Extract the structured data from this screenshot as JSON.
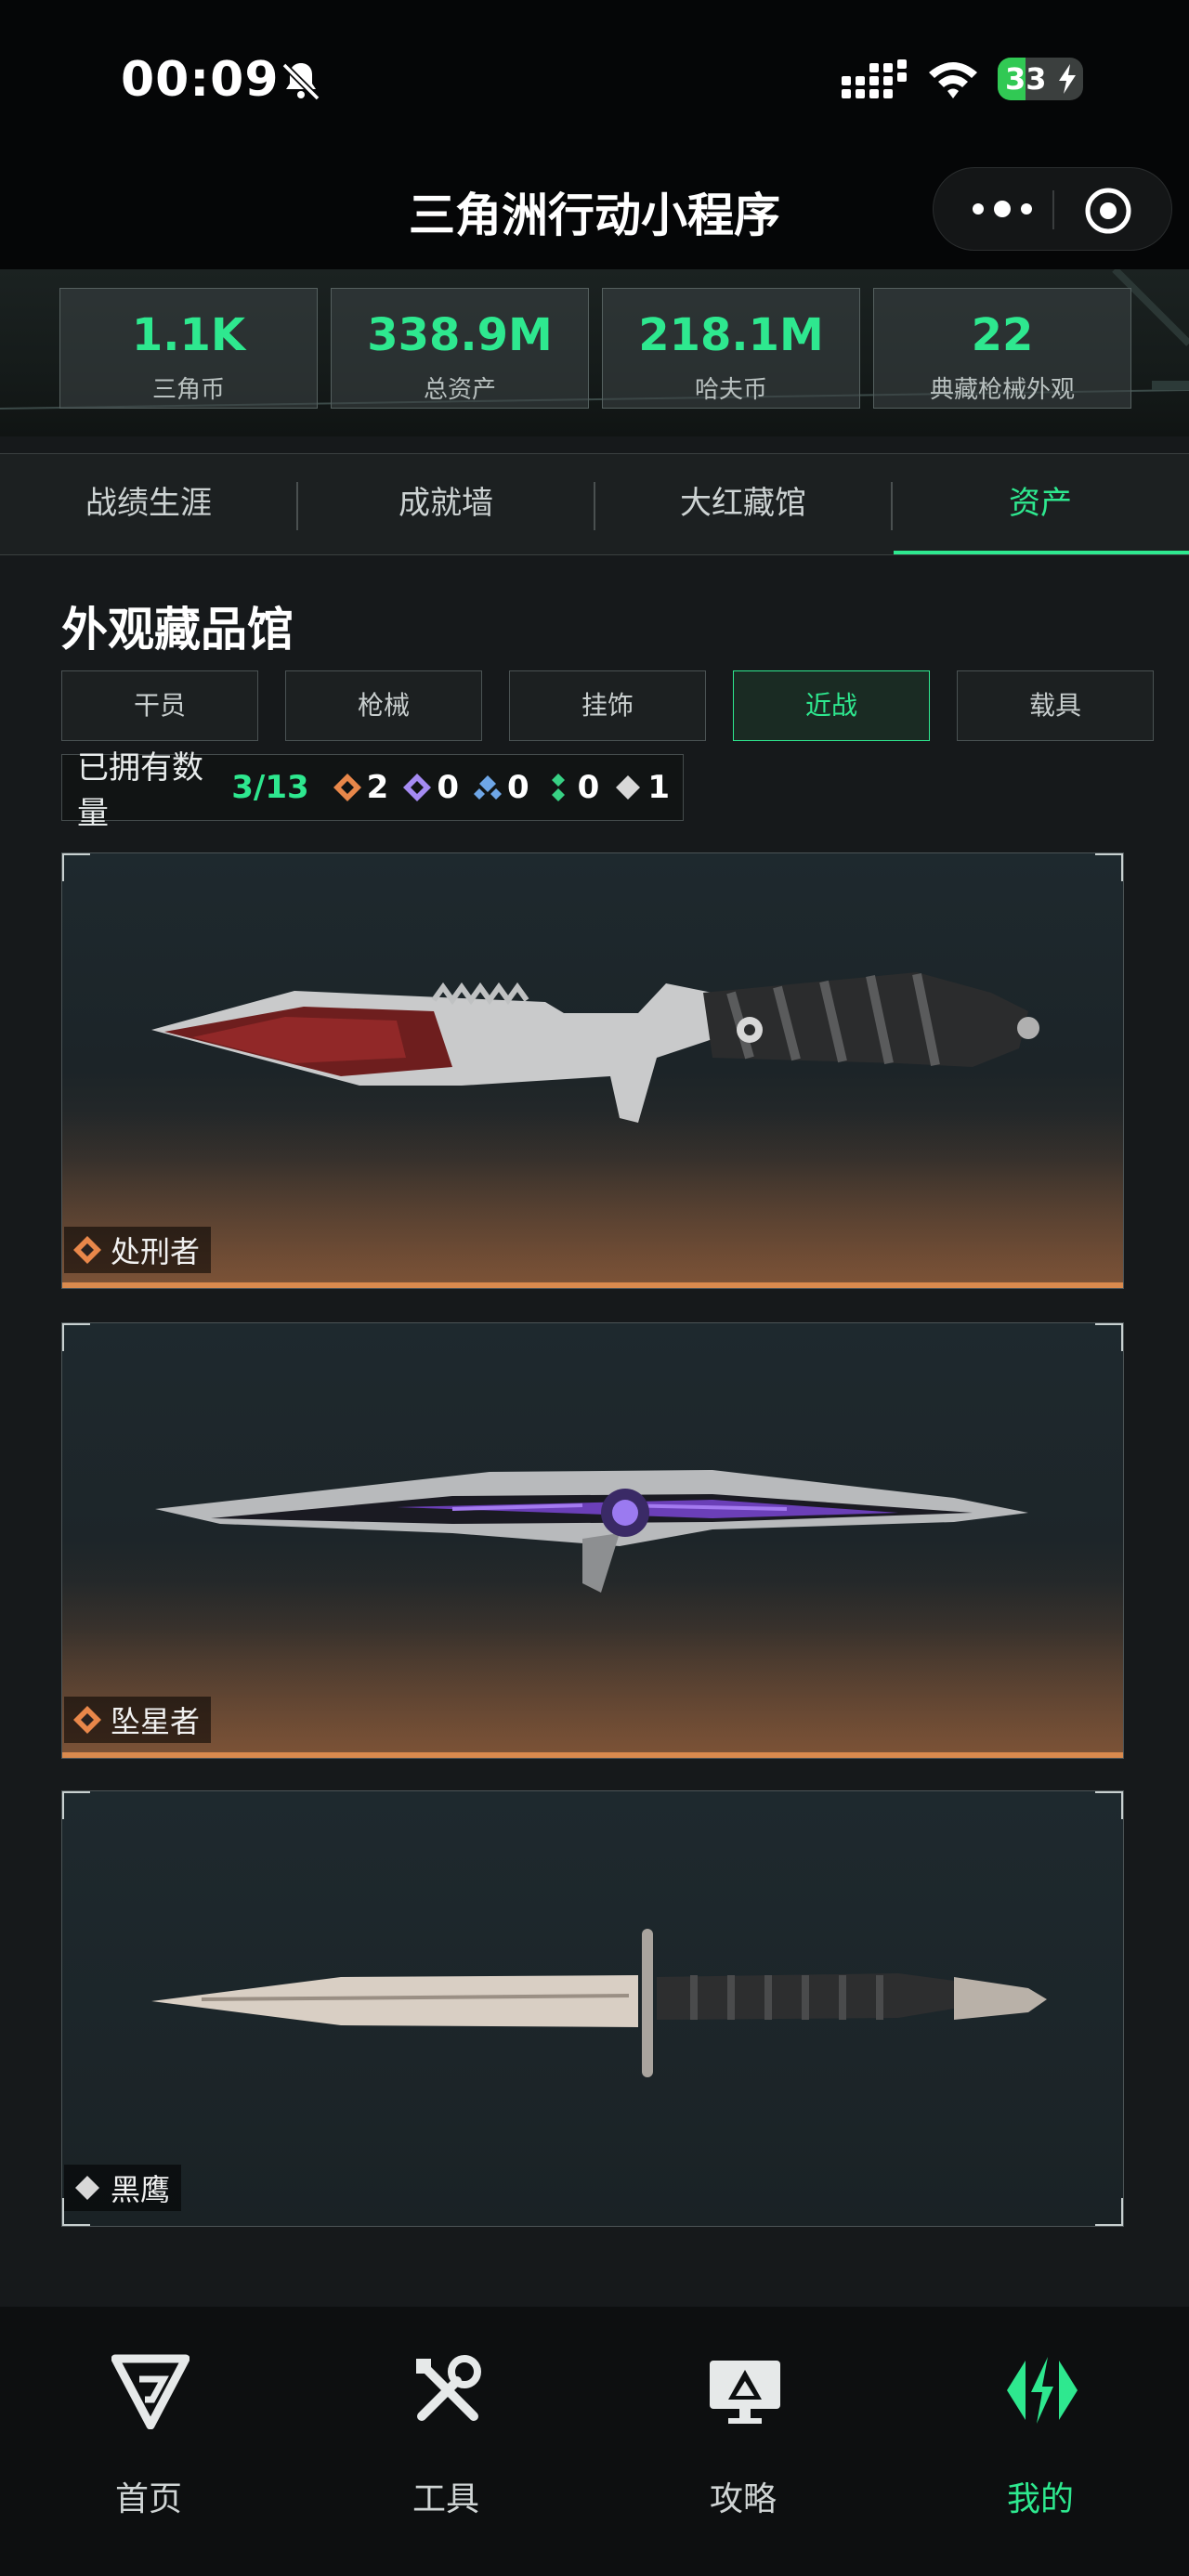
{
  "status_bar": {
    "time": "00:09",
    "battery": "33",
    "battery_level": 0.33
  },
  "header": {
    "title": "三角洲行动小程序"
  },
  "stats": [
    {
      "value": "1.1K",
      "label": "三角币"
    },
    {
      "value": "338.9M",
      "label": "总资产"
    },
    {
      "value": "218.1M",
      "label": "哈夫币"
    },
    {
      "value": "22",
      "label": "典藏枪械外观"
    }
  ],
  "tabs": [
    {
      "label": "战绩生涯",
      "active": false
    },
    {
      "label": "成就墙",
      "active": false
    },
    {
      "label": "大红藏馆",
      "active": false
    },
    {
      "label": "资产",
      "active": true
    }
  ],
  "collection": {
    "title": "外观藏品馆",
    "categories": [
      {
        "label": "干员",
        "active": false
      },
      {
        "label": "枪械",
        "active": false
      },
      {
        "label": "挂饰",
        "active": false
      },
      {
        "label": "近战",
        "active": true
      },
      {
        "label": "载具",
        "active": false
      }
    ],
    "owned_label": "已拥有数量",
    "owned_value": "3/13",
    "rarity_counts": [
      {
        "icon": "orange-diamond-icon",
        "color": "#e8874a",
        "count": "2"
      },
      {
        "icon": "purple-diamond-icon",
        "color": "#a58bf2",
        "count": "0"
      },
      {
        "icon": "blue-diamond-icon",
        "color": "#6ea6e6",
        "count": "0"
      },
      {
        "icon": "green-diamond-icon",
        "color": "#38d184",
        "count": "0"
      },
      {
        "icon": "white-diamond-icon",
        "color": "#d8d8d8",
        "count": "1"
      }
    ],
    "items": [
      {
        "name": "处刑者",
        "rarity_icon": "orange-diamond-icon",
        "accent": "#d98a4e"
      },
      {
        "name": "坠星者",
        "rarity_icon": "orange-diamond-icon",
        "accent": "#d98a4e"
      },
      {
        "name": "黑鹰",
        "rarity_icon": "white-diamond-icon",
        "accent": "#d8d8d8"
      }
    ]
  },
  "tabbar": [
    {
      "label": "首页",
      "icon": "home-logo-icon",
      "active": false
    },
    {
      "label": "工具",
      "icon": "tools-icon",
      "active": false
    },
    {
      "label": "攻略",
      "icon": "guide-monitor-icon",
      "active": false
    },
    {
      "label": "我的",
      "icon": "profile-logo-icon",
      "active": true
    }
  ],
  "colors": {
    "accent": "#2ee88f",
    "background": "#16191b"
  }
}
